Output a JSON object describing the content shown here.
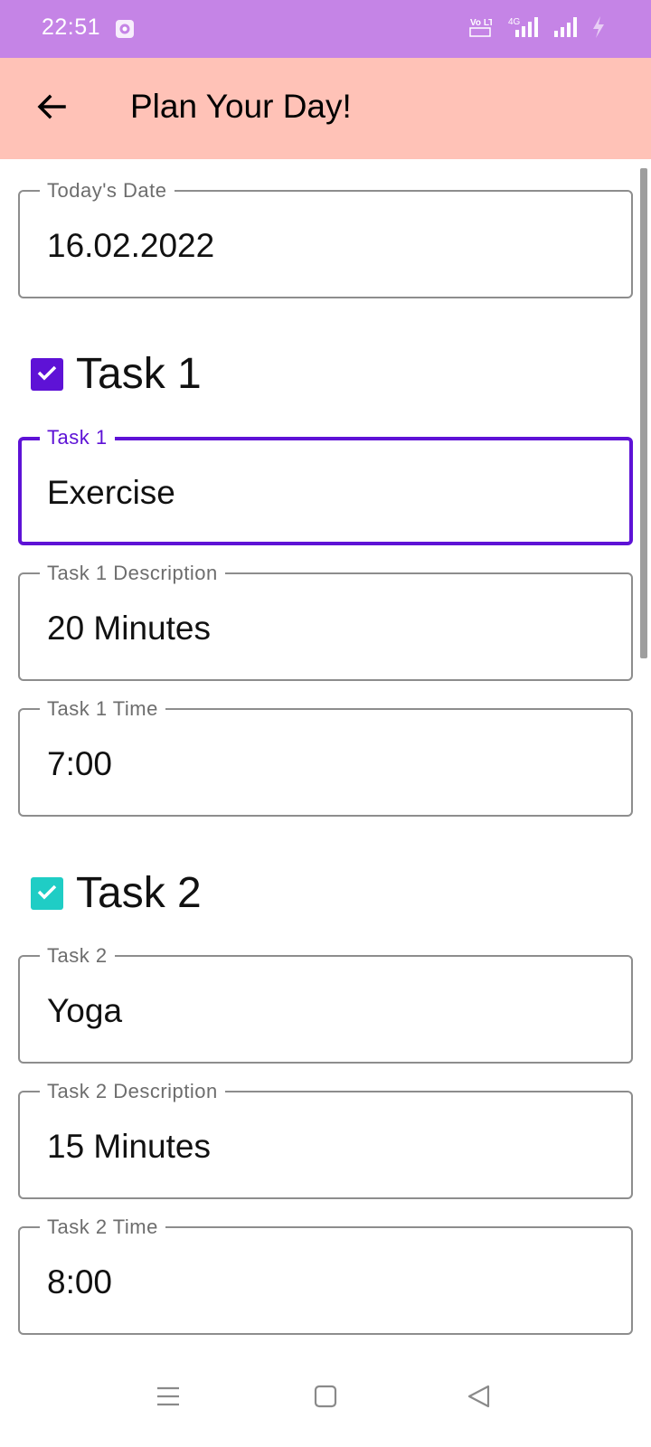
{
  "status_bar": {
    "time": "22:51",
    "icons": [
      "settings-gear-icon",
      "volte-icon",
      "signal-4g-icon",
      "signal-icon",
      "charging-bolt-icon"
    ],
    "volte_label": "Vo LTE",
    "network_label": "4G"
  },
  "app_bar": {
    "title": "Plan Your Day!",
    "back_icon": "arrow-left-icon",
    "background": "#ffc2b7"
  },
  "date_field": {
    "label": "Today's Date",
    "value": "16.02.2022"
  },
  "tasks": [
    {
      "heading": "Task 1",
      "checked": true,
      "checkbox_color": "#5e12d6",
      "name_field": {
        "label": "Task 1",
        "value": "Exercise",
        "focused": true
      },
      "description_field": {
        "label": "Task 1 Description",
        "value": "20 Minutes"
      },
      "time_field": {
        "label": "Task 1 Time",
        "value": "7:00"
      }
    },
    {
      "heading": "Task 2",
      "checked": true,
      "checkbox_color": "#1fcdc5",
      "name_field": {
        "label": "Task 2",
        "value": "Yoga",
        "focused": false
      },
      "description_field": {
        "label": "Task 2 Description",
        "value": "15 Minutes"
      },
      "time_field": {
        "label": "Task 2 Time",
        "value": "8:00"
      }
    }
  ],
  "nav_bar": {
    "icons": [
      "menu-icon",
      "home-square-icon",
      "back-triangle-icon"
    ]
  },
  "colors": {
    "status_bar": "#c584e6",
    "accent": "#5e12d6",
    "outline": "#8d8d8d"
  }
}
